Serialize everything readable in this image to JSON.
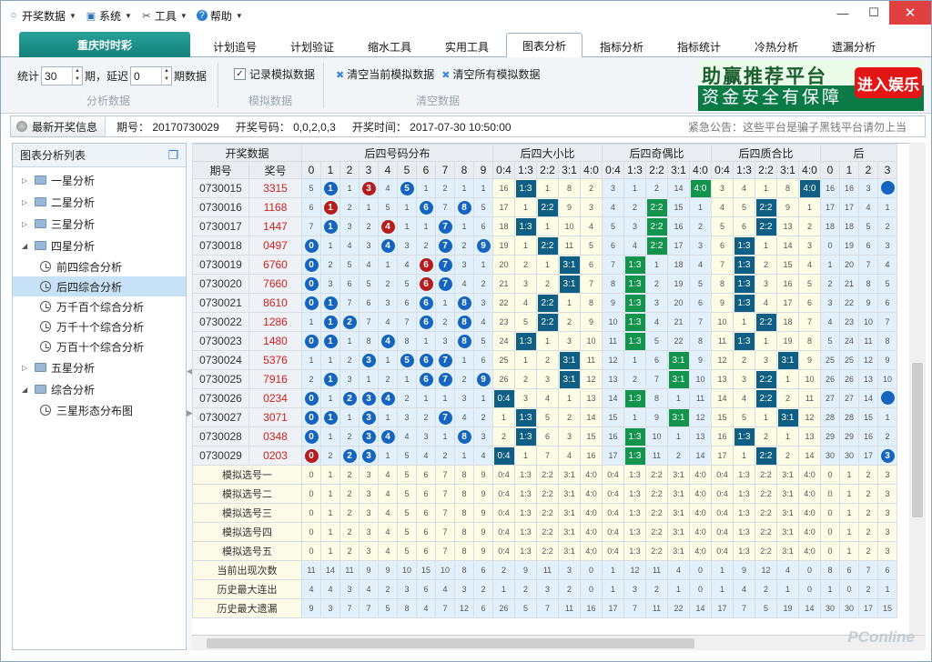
{
  "menu": [
    {
      "label": "开奖数据",
      "icon": "circle-icon"
    },
    {
      "label": "系统",
      "icon": "monitor-icon"
    },
    {
      "label": "工具",
      "icon": "tools-icon"
    },
    {
      "label": "帮助",
      "icon": "help-icon"
    }
  ],
  "window": {
    "min": "—",
    "restore": "☐",
    "close": "✕"
  },
  "tabs": {
    "main": "重庆时时彩",
    "items": [
      "计划追号",
      "计划验证",
      "缩水工具",
      "实用工具",
      "图表分析",
      "指标分析",
      "指标统计",
      "冷热分析",
      "遗漏分析"
    ],
    "active": "图表分析"
  },
  "toolbar": {
    "stat_label": "统计",
    "stat_value": "30",
    "period_label": "期，延迟",
    "delay_value": "0",
    "periods_label": "期数据",
    "group1": "分析数据",
    "record_label": "记录模拟数据",
    "group2": "模拟数据",
    "clear_current": "清空当前模拟数据",
    "clear_all": "清空所有模拟数据",
    "group3": "清空数据"
  },
  "ad": {
    "line1": "助赢推荐平台",
    "line2": "资金安全有保障",
    "button": "进入娱乐"
  },
  "infobar": {
    "btn": "最新开奖信息",
    "period": "期号：  20170730029",
    "numbers": "开奖号码：  0,0,2,0,3",
    "time": "开奖时间：  2017-07-30 10:50:00",
    "notice": "紧急公告：这些平台是骗子黑钱平台请勿上当"
  },
  "sidebar": {
    "title": "图表分析列表",
    "items": [
      {
        "label": "一星分析",
        "open": false
      },
      {
        "label": "二星分析",
        "open": false
      },
      {
        "label": "三星分析",
        "open": false
      },
      {
        "label": "四星分析",
        "open": true,
        "children": [
          "前四综合分析",
          "后四综合分析",
          "万千百个综合分析",
          "万千十个综合分析",
          "万百十个综合分析"
        ]
      },
      {
        "label": "五星分析",
        "open": false
      },
      {
        "label": "综合分析",
        "open": true,
        "children": [
          "三星形态分布图"
        ]
      }
    ],
    "selected": "后四综合分析"
  },
  "table": {
    "group_headers": [
      "开奖数据",
      "后四号码分布",
      "后四大小比",
      "后四奇偶比",
      "后四质合比",
      "后"
    ],
    "col_headers": [
      "期号",
      "奖号",
      "0",
      "1",
      "2",
      "3",
      "4",
      "5",
      "6",
      "7",
      "8",
      "9",
      "0:4",
      "1:3",
      "2:2",
      "3:1",
      "4:0",
      "0:4",
      "1:3",
      "2:2",
      "3:1",
      "4:0",
      "0:4",
      "1:3",
      "2:2",
      "3:1",
      "4:0",
      "0",
      "1",
      "2",
      "3"
    ],
    "rows": [
      {
        "p": "0730015",
        "n": "3315",
        "d": [
          "5",
          "b1",
          "1",
          "r3",
          "4",
          "b5",
          "1",
          "2",
          "1",
          "1"
        ],
        "s": [
          "16",
          "B1:3",
          "1",
          "8",
          "2"
        ],
        "o": [
          "3",
          "1",
          "2",
          "14",
          "G4:0"
        ],
        "q": [
          "3",
          "4",
          "1",
          "8",
          "B4:0"
        ],
        "x": [
          "16",
          "16",
          "3",
          "b"
        ]
      },
      {
        "p": "0730016",
        "n": "1168",
        "d": [
          "6",
          "r1",
          "2",
          "1",
          "5",
          "1",
          "b6",
          "7",
          "b8",
          "5"
        ],
        "s": [
          "17",
          "1",
          "B2:2",
          "9",
          "3"
        ],
        "o": [
          "4",
          "2",
          "G2:2",
          "15",
          "1"
        ],
        "q": [
          "4",
          "5",
          "B2:2",
          "9",
          "1"
        ],
        "x": [
          "17",
          "17",
          "4",
          "1"
        ]
      },
      {
        "p": "0730017",
        "n": "1447",
        "d": [
          "7",
          "b1",
          "3",
          "2",
          "r4",
          "1",
          "1",
          "b7",
          "1",
          "6"
        ],
        "s": [
          "18",
          "B1:3",
          "1",
          "10",
          "4"
        ],
        "o": [
          "5",
          "3",
          "G2:2",
          "16",
          "2"
        ],
        "q": [
          "5",
          "6",
          "B2:2",
          "13",
          "2"
        ],
        "x": [
          "18",
          "18",
          "5",
          "2"
        ]
      },
      {
        "p": "0730018",
        "n": "0497",
        "d": [
          "b0",
          "1",
          "4",
          "3",
          "b4",
          "3",
          "2",
          "b7",
          "2",
          "b9"
        ],
        "s": [
          "19",
          "1",
          "B2:2",
          "11",
          "5"
        ],
        "o": [
          "6",
          "4",
          "G2:2",
          "17",
          "3"
        ],
        "q": [
          "6",
          "B1:3",
          "1",
          "14",
          "3"
        ],
        "x": [
          "0",
          "19",
          "6",
          "3"
        ]
      },
      {
        "p": "0730019",
        "n": "6760",
        "d": [
          "b0",
          "2",
          "5",
          "4",
          "1",
          "4",
          "r6",
          "b7",
          "3",
          "1"
        ],
        "s": [
          "20",
          "2",
          "1",
          "B3:1",
          "6"
        ],
        "o": [
          "7",
          "G1:3",
          "1",
          "18",
          "4"
        ],
        "q": [
          "7",
          "B1:3",
          "2",
          "15",
          "4"
        ],
        "x": [
          "1",
          "20",
          "7",
          "4"
        ]
      },
      {
        "p": "0730020",
        "n": "7660",
        "d": [
          "b0",
          "3",
          "6",
          "5",
          "2",
          "5",
          "r6",
          "b7",
          "4",
          "2"
        ],
        "s": [
          "21",
          "3",
          "2",
          "B3:1",
          "7"
        ],
        "o": [
          "8",
          "G1:3",
          "2",
          "19",
          "5"
        ],
        "q": [
          "8",
          "B1:3",
          "3",
          "16",
          "5"
        ],
        "x": [
          "2",
          "21",
          "8",
          "5"
        ]
      },
      {
        "p": "0730021",
        "n": "8610",
        "d": [
          "b0",
          "b1",
          "7",
          "6",
          "3",
          "6",
          "b6",
          "1",
          "b8",
          "3"
        ],
        "s": [
          "22",
          "4",
          "B2:2",
          "1",
          "8"
        ],
        "o": [
          "9",
          "G1:3",
          "3",
          "20",
          "6"
        ],
        "q": [
          "9",
          "B1:3",
          "4",
          "17",
          "6"
        ],
        "x": [
          "3",
          "22",
          "9",
          "6"
        ]
      },
      {
        "p": "0730022",
        "n": "1286",
        "d": [
          "1",
          "b1",
          "b2",
          "7",
          "4",
          "7",
          "b6",
          "2",
          "b8",
          "4"
        ],
        "s": [
          "23",
          "5",
          "B2:2",
          "2",
          "9"
        ],
        "o": [
          "10",
          "G1:3",
          "4",
          "21",
          "7"
        ],
        "q": [
          "10",
          "1",
          "B2:2",
          "18",
          "7"
        ],
        "x": [
          "4",
          "23",
          "10",
          "7"
        ]
      },
      {
        "p": "0730023",
        "n": "1480",
        "d": [
          "b0",
          "b1",
          "1",
          "8",
          "b4",
          "8",
          "1",
          "3",
          "b8",
          "5"
        ],
        "s": [
          "24",
          "B1:3",
          "1",
          "3",
          "10"
        ],
        "o": [
          "11",
          "G1:3",
          "5",
          "22",
          "8"
        ],
        "q": [
          "11",
          "B1:3",
          "1",
          "19",
          "8"
        ],
        "x": [
          "5",
          "24",
          "11",
          "8"
        ]
      },
      {
        "p": "0730024",
        "n": "5376",
        "d": [
          "1",
          "1",
          "2",
          "b3",
          "1",
          "b5",
          "b6",
          "b7",
          "1",
          "6"
        ],
        "s": [
          "25",
          "1",
          "2",
          "B3:1",
          "11"
        ],
        "o": [
          "12",
          "1",
          "6",
          "G3:1",
          "9"
        ],
        "q": [
          "12",
          "2",
          "3",
          "B3:1",
          "9"
        ],
        "x": [
          "25",
          "25",
          "12",
          "9"
        ]
      },
      {
        "p": "0730025",
        "n": "7916",
        "d": [
          "2",
          "b1",
          "3",
          "1",
          "2",
          "1",
          "b6",
          "b7",
          "2",
          "b9"
        ],
        "s": [
          "26",
          "2",
          "3",
          "B3:1",
          "12"
        ],
        "o": [
          "13",
          "2",
          "7",
          "G3:1",
          "10"
        ],
        "q": [
          "13",
          "3",
          "B2:2",
          "1",
          "10"
        ],
        "x": [
          "26",
          "26",
          "13",
          "10"
        ]
      },
      {
        "p": "0730026",
        "n": "0234",
        "d": [
          "b0",
          "1",
          "b2",
          "b3",
          "b4",
          "2",
          "1",
          "1",
          "3",
          "1"
        ],
        "s": [
          "B0:4",
          "3",
          "4",
          "1",
          "13"
        ],
        "o": [
          "14",
          "G1:3",
          "8",
          "1",
          "11"
        ],
        "q": [
          "14",
          "4",
          "B2:2",
          "2",
          "11"
        ],
        "x": [
          "27",
          "27",
          "14",
          "b"
        ]
      },
      {
        "p": "0730027",
        "n": "3071",
        "d": [
          "b0",
          "b1",
          "1",
          "b3",
          "1",
          "3",
          "2",
          "b7",
          "4",
          "2"
        ],
        "s": [
          "1",
          "B1:3",
          "5",
          "2",
          "14"
        ],
        "o": [
          "15",
          "1",
          "9",
          "G3:1",
          "12"
        ],
        "q": [
          "15",
          "5",
          "1",
          "B3:1",
          "12"
        ],
        "x": [
          "28",
          "28",
          "15",
          "1"
        ]
      },
      {
        "p": "0730028",
        "n": "0348",
        "d": [
          "b0",
          "1",
          "2",
          "b3",
          "b4",
          "4",
          "3",
          "1",
          "b8",
          "3"
        ],
        "s": [
          "2",
          "B1:3",
          "6",
          "3",
          "15"
        ],
        "o": [
          "16",
          "G1:3",
          "10",
          "1",
          "13"
        ],
        "q": [
          "16",
          "B1:3",
          "2",
          "1",
          "13"
        ],
        "x": [
          "29",
          "29",
          "16",
          "2"
        ]
      },
      {
        "p": "0730029",
        "n": "0203",
        "d": [
          "r0",
          "2",
          "b2",
          "b3",
          "1",
          "5",
          "4",
          "2",
          "1",
          "4"
        ],
        "s": [
          "B0:4",
          "1",
          "7",
          "4",
          "16"
        ],
        "o": [
          "17",
          "G1:3",
          "11",
          "2",
          "14"
        ],
        "q": [
          "17",
          "1",
          "B2:2",
          "2",
          "14"
        ],
        "x": [
          "30",
          "30",
          "17",
          "b3"
        ]
      }
    ],
    "sim_rows": [
      "模拟选号一",
      "模拟选号二",
      "模拟选号三",
      "模拟选号四",
      "模拟选号五"
    ],
    "stat_rows": [
      {
        "label": "当前出现次数",
        "d": [
          "11",
          "14",
          "11",
          "9",
          "9",
          "10",
          "15",
          "10",
          "8",
          "6"
        ],
        "s": [
          "2",
          "9",
          "11",
          "3",
          "0"
        ],
        "o": [
          "1",
          "12",
          "11",
          "4",
          "0"
        ],
        "q": [
          "1",
          "9",
          "12",
          "4",
          "0"
        ],
        "x": [
          "8",
          "6",
          "7",
          "6"
        ]
      },
      {
        "label": "历史最大连出",
        "d": [
          "4",
          "4",
          "3",
          "4",
          "2",
          "3",
          "6",
          "4",
          "3",
          "2"
        ],
        "s": [
          "1",
          "2",
          "3",
          "2",
          "0"
        ],
        "o": [
          "1",
          "3",
          "2",
          "1",
          "0"
        ],
        "q": [
          "1",
          "4",
          "2",
          "1",
          "0"
        ],
        "x": [
          "1",
          "0",
          "2",
          "1"
        ]
      },
      {
        "label": "历史最大遗漏",
        "d": [
          "9",
          "3",
          "7",
          "7",
          "5",
          "8",
          "4",
          "7",
          "12",
          "6"
        ],
        "s": [
          "26",
          "5",
          "7",
          "11",
          "16"
        ],
        "o": [
          "17",
          "7",
          "11",
          "22",
          "14"
        ],
        "q": [
          "17",
          "7",
          "5",
          "19",
          "14"
        ],
        "x": [
          "30",
          "30",
          "17",
          "15"
        ]
      }
    ]
  },
  "watermark": "PConline"
}
